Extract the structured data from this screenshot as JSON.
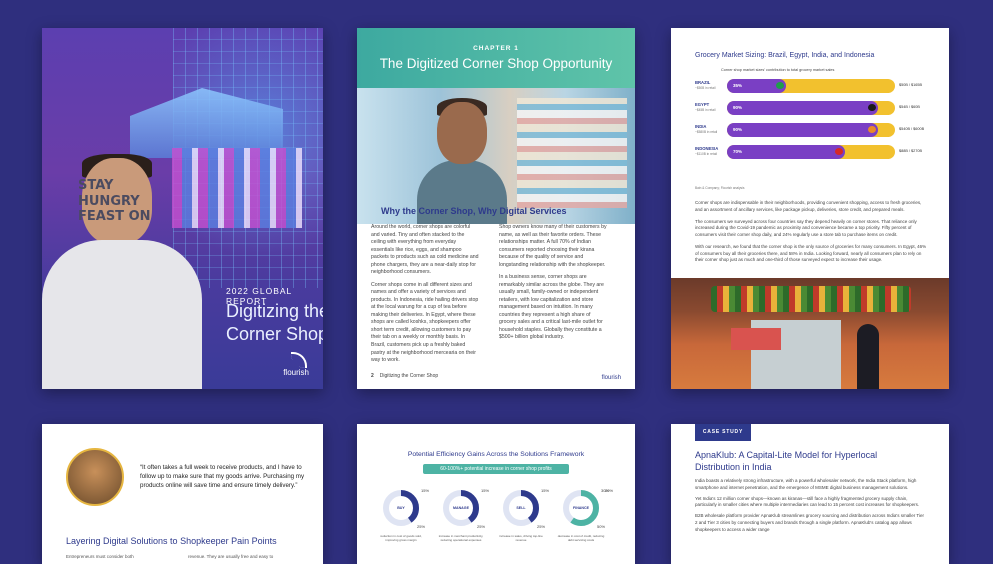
{
  "cover": {
    "overline": "2022 GLOBAL REPORT",
    "title": "Digitizing the Corner Shop",
    "shirt_text": "STAY HUNGRY\nFEAST ON",
    "logo": "flourish"
  },
  "chapter": {
    "label": "CHAPTER 1",
    "title": "The Digitized Corner Shop Opportunity",
    "section_title": "Why the Corner Shop, Why Digital Services",
    "col1": [
      "Around the world, corner shops are colorful and varied. Tiny and often stacked to the ceiling with everything from everyday essentials like rice, eggs, and shampoo packets to products such as cold medicine and phone chargers, they are a near-daily stop for neighborhood consumers.",
      "Corner shops come in all different sizes and names and offer a variety of services and products. In Indonesia, ride hailing drivers stop at the local warung for a cup of tea before making their deliveries. In Egypt, where these shops are called koshks, shopkeepers offer short term credit, allowing customers to pay their tab on a weekly or monthly basis. In Brazil, customers pick up a freshly baked pastry at the neighborhood mercearia on their way to work."
    ],
    "col2": [
      "Shop owners know many of their customers by name, as well as their favorite orders. These relationships matter. A full 70% of Indian consumers reported choosing their kirana because of the quality of service and longstanding relationship with the shopkeeper.",
      "In a business sense, corner shops are remarkably similar across the globe. They are usually small, family-owned or independent retailers, with low capitalization and store management based on intuition. In many countries they represent a high share of grocery sales and a critical last-mile outlet for household staples. Globally they constitute a $500+ billion global industry."
    ],
    "footer_page": "2",
    "footer_text": "Digitizing the Corner Shop",
    "logo": "flourish"
  },
  "market": {
    "title": "Grocery Market Sizing: Brazil, Egypt, India, and Indonesia",
    "legend": "Corner shop market sizes' contribution to total grocery market sales",
    "source": "Bain & Company; Flourish analysis",
    "body": [
      "Corner shops are indispensable in their neighborhoods, providing convenient shopping, access to fresh groceries, and an assortment of ancillary services, like package pickup, deliveries, store credit, and prepared meals.",
      "The consumers we surveyed across four countries say they depend heavily on corner stores. That reliance only increased during the Covid-19 pandemic as proximity and convenience became a top priority. Fifty percent of consumers visit their corner shop daily, and 24% regularly use a store tab to purchase items on credit.",
      "With our research, we found that the corner shop is the only source of groceries for many consumers. In Egypt, 46% of consumers buy all their groceries there, and 58% in India. Looking forward, nearly all consumers plan to rely on their corner shop just as much and one-third of those surveyed expect to increase their usage."
    ]
  },
  "chart_data": {
    "type": "bar",
    "title": "Grocery Market Sizing: Brazil, Egypt, India, and Indonesia",
    "legend": "Corner shop market sizes' contribution to total grocery market sales",
    "categories": [
      "BRAZIL",
      "EGYPT",
      "INDIA",
      "INDONESIA"
    ],
    "subtitles": [
      "~$50B in retail",
      "~$45B in retail",
      "~$580B in retail",
      "~$110B in retail"
    ],
    "values": [
      35,
      90,
      90,
      70
    ],
    "value_labels": [
      "35%",
      "90%",
      "90%",
      "70%"
    ],
    "totals": [
      "$50B / $165B",
      "$54B / $60B",
      "$540B / $600B",
      "$88B / $270B"
    ],
    "flag_colors": [
      "#1f9d4a",
      "#1a1a1a",
      "#e8892b",
      "#d62828"
    ],
    "ylim": [
      0,
      100
    ]
  },
  "quote": {
    "text": "“It often takes a full week to receive products, and I have to follow up to make sure that my goods arrive. Purchasing my products online will save time and ensure timely delivery.”",
    "section_title": "Layering Digital Solutions to Shopkeeper Pain Points",
    "col1": "Entrepreneurs must consider both",
    "col2": "revenue. They are usually free and easy to"
  },
  "framework": {
    "title": "Potential Efficiency Gains Across the Solutions Framework",
    "pill": "60-100%+ potential increase in corner shop profits",
    "donuts": [
      {
        "label": "BUY",
        "pct_a": "15%",
        "pct_b": "25%",
        "caption": "reduction in cost of goods sold, improving gross margin"
      },
      {
        "label": "MANAGE",
        "pct_a": "15%",
        "pct_b": "25%",
        "caption": "increase in merchant productivity, reducing operational expenses"
      },
      {
        "label": "SELL",
        "pct_a": "15%",
        "pct_b": "25%",
        "caption": "increase in sales, driving top-line revenue"
      },
      {
        "label": "FINANCE",
        "pct_a": "30%",
        "pct_b": "50%",
        "caption": "decrease in cost of credit, reducing debt servicing costs"
      }
    ],
    "extra_pct": "20%"
  },
  "case": {
    "tag": "CASE STUDY",
    "title": "ApnaKlub: A Capital-Lite Model for Hyperlocal Distribution in India",
    "body": [
      "India boasts a relatively strong infrastructure, with a powerful wholesaler network, the India Stack platform, high smartphone and internet penetration, and the emergence of MSME digital business management solutions.",
      "Yet India's 12 million corner shops—known as kiranas—still face a highly fragmented grocery supply chain, particularly in smaller cities where multiple intermediaries can lead to 15 percent cost increases for shopkeepers.",
      "B2B wholesale platform provider ApnaKlub streamlines grocery sourcing and distribution across India's smaller Tier 2 and Tier 3 cities by connecting buyers and brands through a single platform. ApnaKlub's catalog app allows shopkeepers to access a wider range"
    ]
  },
  "colors": {
    "background": "#2f2f7e",
    "navy": "#2e3a8c",
    "teal": "#4db3a4",
    "purple": "#7a3fc4",
    "yellow": "#f2c12e"
  }
}
